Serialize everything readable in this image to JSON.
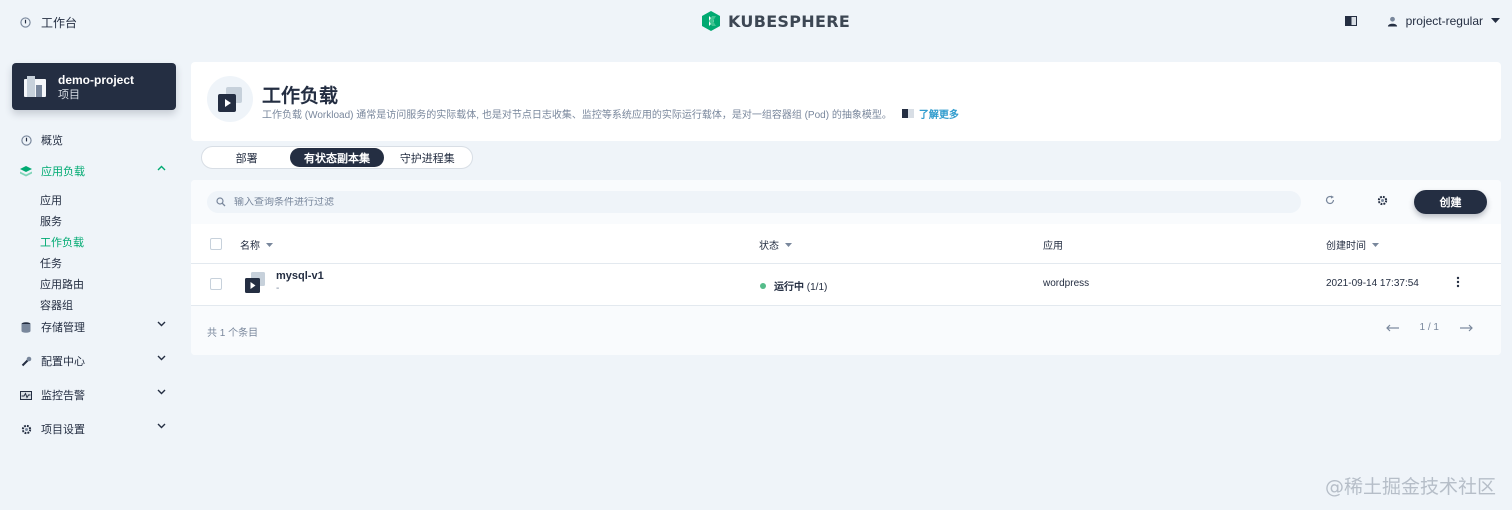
{
  "topbar": {
    "workspace_label": "工作台",
    "brand": "KUBESPHERE",
    "user": "project-regular"
  },
  "project": {
    "name": "demo-project",
    "type": "项目"
  },
  "nav": {
    "overview": "概览",
    "workloads_group": "应用负载",
    "sub": {
      "apps": "应用",
      "services": "服务",
      "workloads": "工作负载",
      "jobs": "任务",
      "routes": "应用路由",
      "pods": "容器组"
    },
    "storage": "存储管理",
    "config": "配置中心",
    "monitoring": "监控告警",
    "settings": "项目设置"
  },
  "banner": {
    "title": "工作负载",
    "description": "工作负载 (Workload) 通常是访问服务的实际载体, 也是对节点日志收集、监控等系统应用的实际运行载体，是对一组容器组 (Pod) 的抽象模型。",
    "learn_more": "了解更多"
  },
  "tabs": {
    "deployments": "部署",
    "statefulsets": "有状态副本集",
    "daemonsets": "守护进程集"
  },
  "toolbar": {
    "search_placeholder": "输入查询条件进行过滤",
    "create": "创建"
  },
  "table": {
    "columns": {
      "name": "名称",
      "status": "状态",
      "app": "应用",
      "created": "创建时间"
    },
    "rows": [
      {
        "name": "mysql-v1",
        "sub": "-",
        "status": "运行中",
        "replicas": "(1/1)",
        "app": "wordpress",
        "created": "2021-09-14 17:37:54"
      }
    ]
  },
  "footer": {
    "total": "共 1 个条目",
    "page": "1 / 1"
  },
  "watermark": "@稀土掘金技术社区",
  "colors": {
    "dark": "#242e42",
    "accent_green": "#00aa72",
    "running": "#55bc8a",
    "link_blue": "#329dce",
    "background": "#eff4f9"
  }
}
